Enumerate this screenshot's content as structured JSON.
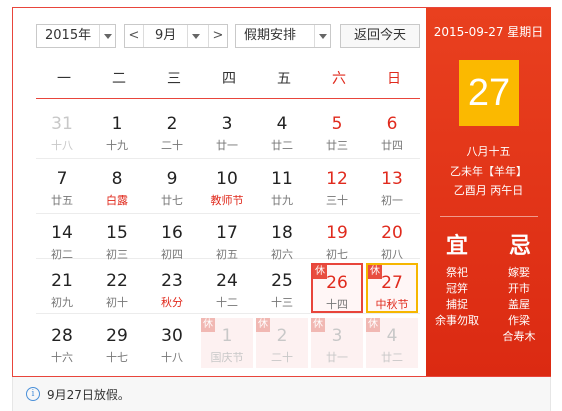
{
  "toolbar": {
    "year": "2015年",
    "prev_month": "<",
    "month": "9月",
    "next_month": ">",
    "holiday": "假期安排",
    "today_button": "返回今天"
  },
  "weekdays": [
    "一",
    "二",
    "三",
    "四",
    "五",
    "六",
    "日"
  ],
  "days": [
    {
      "d": "31",
      "l": "十八",
      "other": true
    },
    {
      "d": "1",
      "l": "十九"
    },
    {
      "d": "2",
      "l": "二十"
    },
    {
      "d": "3",
      "l": "廿一"
    },
    {
      "d": "4",
      "l": "廿二"
    },
    {
      "d": "5",
      "l": "廿三",
      "wkend": true
    },
    {
      "d": "6",
      "l": "廿四",
      "wkend": true
    },
    {
      "d": "7",
      "l": "廿五"
    },
    {
      "d": "8",
      "l": "白露",
      "fest": true
    },
    {
      "d": "9",
      "l": "廿七"
    },
    {
      "d": "10",
      "l": "教师节",
      "fest": true
    },
    {
      "d": "11",
      "l": "廿九"
    },
    {
      "d": "12",
      "l": "三十",
      "wkend": true
    },
    {
      "d": "13",
      "l": "初一",
      "wkend": true
    },
    {
      "d": "14",
      "l": "初二"
    },
    {
      "d": "15",
      "l": "初三"
    },
    {
      "d": "16",
      "l": "初四"
    },
    {
      "d": "17",
      "l": "初五"
    },
    {
      "d": "18",
      "l": "初六"
    },
    {
      "d": "19",
      "l": "初七",
      "wkend": true
    },
    {
      "d": "20",
      "l": "初八",
      "wkend": true
    },
    {
      "d": "21",
      "l": "初九"
    },
    {
      "d": "22",
      "l": "初十"
    },
    {
      "d": "23",
      "l": "秋分",
      "fest": true
    },
    {
      "d": "24",
      "l": "十二"
    },
    {
      "d": "25",
      "l": "十三"
    },
    {
      "d": "26",
      "l": "十四",
      "wkend": true,
      "hol": true,
      "boxed": true,
      "tag": "休"
    },
    {
      "d": "27",
      "l": "中秋节",
      "wkend": true,
      "hol": true,
      "sel": true,
      "fest": true,
      "tag": "休"
    },
    {
      "d": "28",
      "l": "十六"
    },
    {
      "d": "29",
      "l": "十七"
    },
    {
      "d": "30",
      "l": "十八"
    },
    {
      "d": "1",
      "l": "国庆节",
      "other": true,
      "hol": true,
      "tag": "休"
    },
    {
      "d": "2",
      "l": "二十",
      "other": true,
      "hol": true,
      "tag": "休"
    },
    {
      "d": "3",
      "l": "廿一",
      "other": true,
      "hol": true,
      "tag": "休"
    },
    {
      "d": "4",
      "l": "廿二",
      "other": true,
      "hol": true,
      "tag": "休"
    }
  ],
  "side": {
    "date_line": "2015-09-27 星期日",
    "big_day": "27",
    "lunar": "八月十五",
    "ganzhi_year": "乙未年【羊年】",
    "ganzhi_month_day": "乙酉月 丙午日",
    "yi_label": "宜",
    "ji_label": "忌",
    "yi_items": [
      "祭祀",
      "冠笄",
      "捕捉",
      "余事勿取"
    ],
    "ji_items": [
      "嫁娶",
      "开市",
      "盖屋",
      "作梁",
      "合寿木"
    ]
  },
  "info": {
    "icon": "i",
    "text": "9月27日放假。"
  }
}
